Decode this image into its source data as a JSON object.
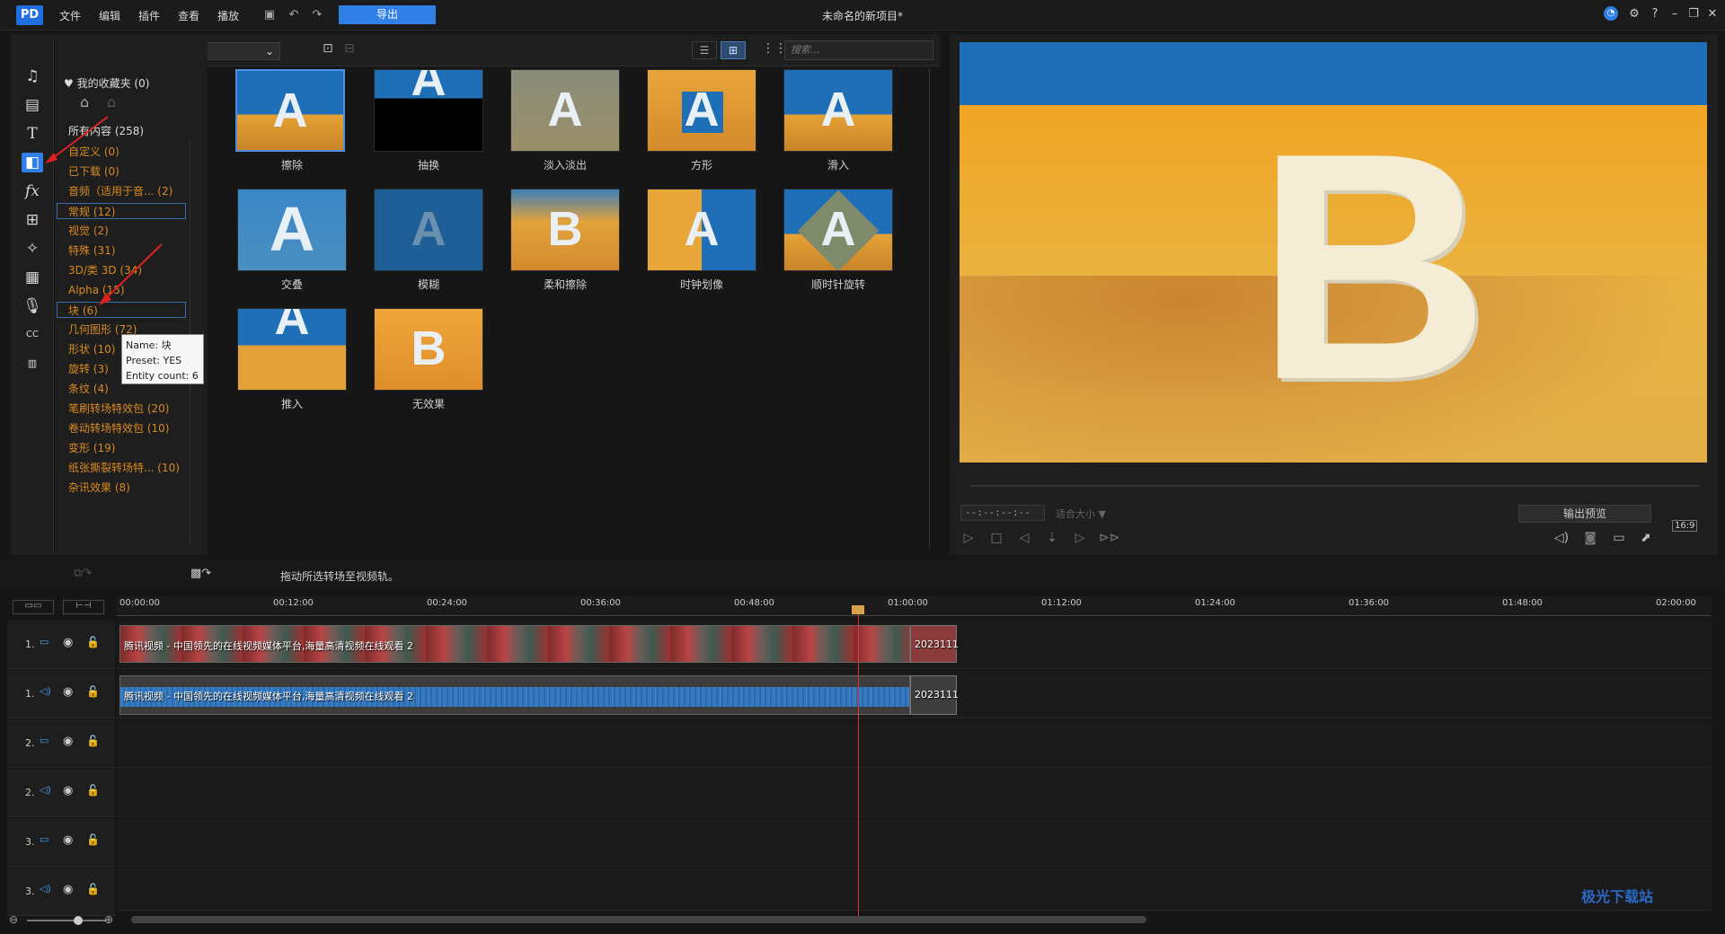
{
  "app": {
    "title": "未命名的新项目*",
    "logo": "PD"
  },
  "menu": [
    "文件",
    "编辑",
    "插件",
    "查看",
    "播放"
  ],
  "toolbar": {
    "export_label": "导出",
    "save_icon": "save-icon",
    "undo_icon": "undo-icon",
    "redo_icon": "redo-icon"
  },
  "window_controls": [
    "notification-icon",
    "gear-icon",
    "help-icon",
    "minimize-icon",
    "restore-icon",
    "close-icon"
  ],
  "sidebar": {
    "icons": [
      "media-room-icon",
      "video-room-icon",
      "title-icon",
      "transition-icon",
      "fx-icon",
      "pip-icon",
      "particle-icon",
      "voice-icon",
      "mic-icon",
      "subtitle-icon",
      "chapter-icon"
    ],
    "active": "transition-icon"
  },
  "library": {
    "preset": "常规",
    "search_placeholder": "搜索...",
    "favorites": "我的收藏夹 (0)",
    "categories": [
      "所有内容 (258)",
      "自定义 (0)",
      "已下载 (0)",
      "音频（适用于音... (2)",
      "常规 (12)",
      "视觉 (2)",
      "特殊 (31)",
      "3D/类 3D (34)",
      "Alpha (15)",
      "块 (6)",
      "几何图形 (72)",
      "形状 (10)",
      "旋转 (3)",
      "条纹 (4)",
      "笔刷转场特效包 (20)",
      "卷动转场特效包 (10)",
      "变形 (19)",
      "纸张撕裂转场特... (10)",
      "杂讯效果 (8)"
    ],
    "selected": "常规 (12)",
    "tooltip": {
      "name": "Name: 块",
      "preset": "Preset: YES",
      "count": "Entity count: 6"
    },
    "items": [
      "擦除",
      "抽换",
      "淡入淡出",
      "方形",
      "滑入",
      "交叠",
      "模糊",
      "柔和擦除",
      "时钟划像",
      "顺时针旋转",
      "推入",
      "无效果"
    ]
  },
  "preview": {
    "timecode": "--:--:--:--",
    "fit": "适合大小 ▼",
    "output_preview": "输出预览",
    "aspect": "16:9",
    "letter": "B"
  },
  "timeline": {
    "hint": "拖动所选转场至视频轨。",
    "ticks": [
      "00:00:00",
      "00:12:00",
      "00:24:00",
      "00:36:00",
      "00:48:00",
      "01:00:00",
      "01:12:00",
      "01:24:00",
      "01:36:00",
      "01:48:00",
      "02:00:00"
    ],
    "tracks": [
      {
        "num": "1."
      },
      {
        "num": "1."
      },
      {
        "num": "2."
      },
      {
        "num": "2."
      },
      {
        "num": "3."
      },
      {
        "num": "3."
      }
    ],
    "video_clip": "腾讯视频 - 中国领先的在线视频媒体平台,海量高清视频在线观看 2",
    "video_clip2": "2023111",
    "audio_clip": "腾讯视频 - 中国领先的在线视频媒体平台,海量高清视频在线观看 2",
    "audio_clip2": "2023111"
  },
  "watermark": "极光下载站"
}
